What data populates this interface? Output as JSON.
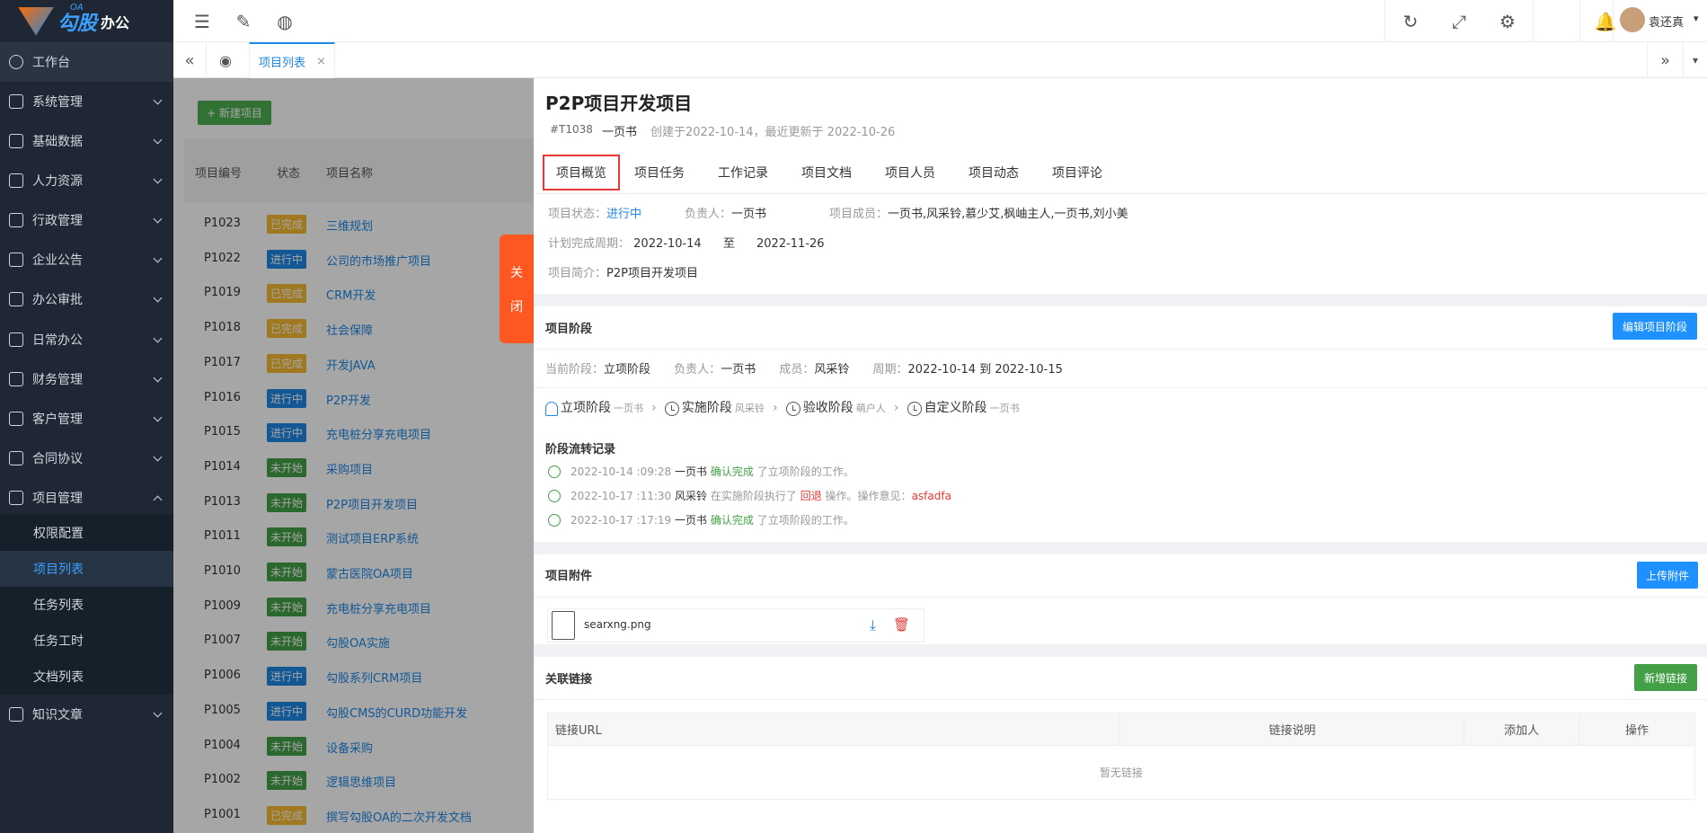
{
  "brand": {
    "oa": "OA",
    "name": "勾股",
    "suffix": "办公"
  },
  "sidebar": {
    "workbench": "工作台",
    "items": [
      {
        "label": "系统管理"
      },
      {
        "label": "基础数据"
      },
      {
        "label": "人力资源"
      },
      {
        "label": "行政管理"
      },
      {
        "label": "企业公告"
      },
      {
        "label": "办公审批"
      },
      {
        "label": "日常办公"
      },
      {
        "label": "财务管理"
      },
      {
        "label": "客户管理"
      },
      {
        "label": "合同协议"
      },
      {
        "label": "项目管理"
      },
      {
        "label": "知识文章"
      }
    ],
    "subitems": [
      {
        "label": "权限配置"
      },
      {
        "label": "项目列表"
      },
      {
        "label": "任务列表"
      },
      {
        "label": "任务工时"
      },
      {
        "label": "文档列表"
      }
    ]
  },
  "topbar": {
    "user_name": "袁还真"
  },
  "tabs": {
    "active_tab": "项目列表"
  },
  "list": {
    "new_button": "+ 新建项目",
    "headers": {
      "code": "项目编号",
      "status": "状态",
      "name": "项目名称"
    },
    "rows": [
      {
        "code": "P1023",
        "status": "已完成",
        "name": "三维规划"
      },
      {
        "code": "P1022",
        "status": "进行中",
        "name": "公司的市场推广项目"
      },
      {
        "code": "P1019",
        "status": "已完成",
        "name": "CRM开发"
      },
      {
        "code": "P1018",
        "status": "已完成",
        "name": "社会保障"
      },
      {
        "code": "P1017",
        "status": "已完成",
        "name": "开发JAVA"
      },
      {
        "code": "P1016",
        "status": "进行中",
        "name": "P2P开发"
      },
      {
        "code": "P1015",
        "status": "进行中",
        "name": "充电桩分享充电项目"
      },
      {
        "code": "P1014",
        "status": "未开始",
        "name": "采购项目"
      },
      {
        "code": "P1013",
        "status": "未开始",
        "name": "P2P项目开发项目"
      },
      {
        "code": "P1011",
        "status": "未开始",
        "name": "测试项目ERP系统"
      },
      {
        "code": "P1010",
        "status": "未开始",
        "name": "蒙古医院OA项目"
      },
      {
        "code": "P1009",
        "status": "未开始",
        "name": "充电桩分享充电项目"
      },
      {
        "code": "P1007",
        "status": "未开始",
        "name": "勾股OA实施"
      },
      {
        "code": "P1006",
        "status": "进行中",
        "name": "勾股系列CRM项目"
      },
      {
        "code": "P1005",
        "status": "进行中",
        "name": "勾股CMS的CURD功能开发"
      },
      {
        "code": "P1004",
        "status": "未开始",
        "name": "设备采购"
      },
      {
        "code": "P1002",
        "status": "未开始",
        "name": "逻辑思维项目"
      },
      {
        "code": "P1001",
        "status": "已完成",
        "name": "撰写勾股OA的二次开发文档"
      }
    ],
    "status_colors": {
      "已完成": "#f5b830",
      "进行中": "#1e88e5",
      "未开始": "#43a047"
    }
  },
  "close_tab": {
    "char1": "关",
    "char2": "闭"
  },
  "project": {
    "title": "P2P项目开发项目",
    "id": "#T1038",
    "owner": "一页书",
    "created": "创建于2022-10-14，最近更新于 2022-10-26",
    "tabs": [
      "项目概览",
      "项目任务",
      "工作记录",
      "项目文档",
      "项目人员",
      "项目动态",
      "项目评论"
    ],
    "overview": {
      "status_label": "项目状态：",
      "status_value": "进行中",
      "leader_label": "负责人：",
      "leader_value": "一页书",
      "members_label": "项目成员：",
      "members_value": "一页书,风采铃,慕少艾,枫岫主人,一页书,刘小美",
      "period_label": "计划完成周期：",
      "period_start": "2022-10-14",
      "period_to": "至",
      "period_end": "2022-11-26",
      "intro_label": "项目简介：",
      "intro_value": "P2P项目开发项目"
    },
    "stage": {
      "title": "项目阶段",
      "edit_button": "编辑项目阶段",
      "current_label": "当前阶段：",
      "current_value": "立项阶段",
      "leader_label": "负责人：",
      "leader_value": "一页书",
      "member_label": "成员：",
      "member_value": "风采铃",
      "period_label": "周期：",
      "period_value": "2022-10-14 到 2022-10-15",
      "steps": [
        {
          "name": "立项阶段",
          "person": "一页书"
        },
        {
          "name": "实施阶段",
          "person": "风采铃"
        },
        {
          "name": "验收阶段",
          "person": "萌户人"
        },
        {
          "name": "自定义阶段",
          "person": "一页书"
        }
      ],
      "flow_title": "阶段流转记录",
      "flow": [
        {
          "time": "2022-10-14 :09:28",
          "user": "一页书",
          "action": "确认完成",
          "rest": "了立项阶段的工作。",
          "extra": ""
        },
        {
          "time": "2022-10-17 :11:30",
          "user": "风采铃",
          "action_prefix": "在实施阶段执行了",
          "action": "回退",
          "rest": "操作。操作意见：",
          "extra": "asfadfa"
        },
        {
          "time": "2022-10-17 :17:19",
          "user": "一页书",
          "action": "确认完成",
          "rest": "了立项阶段的工作。",
          "extra": ""
        }
      ]
    },
    "attachments": {
      "title": "项目附件",
      "upload_button": "上传附件",
      "file_name": "searxng.png"
    },
    "links": {
      "title": "关联链接",
      "add_button": "新增链接",
      "headers": [
        "链接URL",
        "链接说明",
        "添加人",
        "操作"
      ],
      "empty": "暂无链接"
    }
  }
}
